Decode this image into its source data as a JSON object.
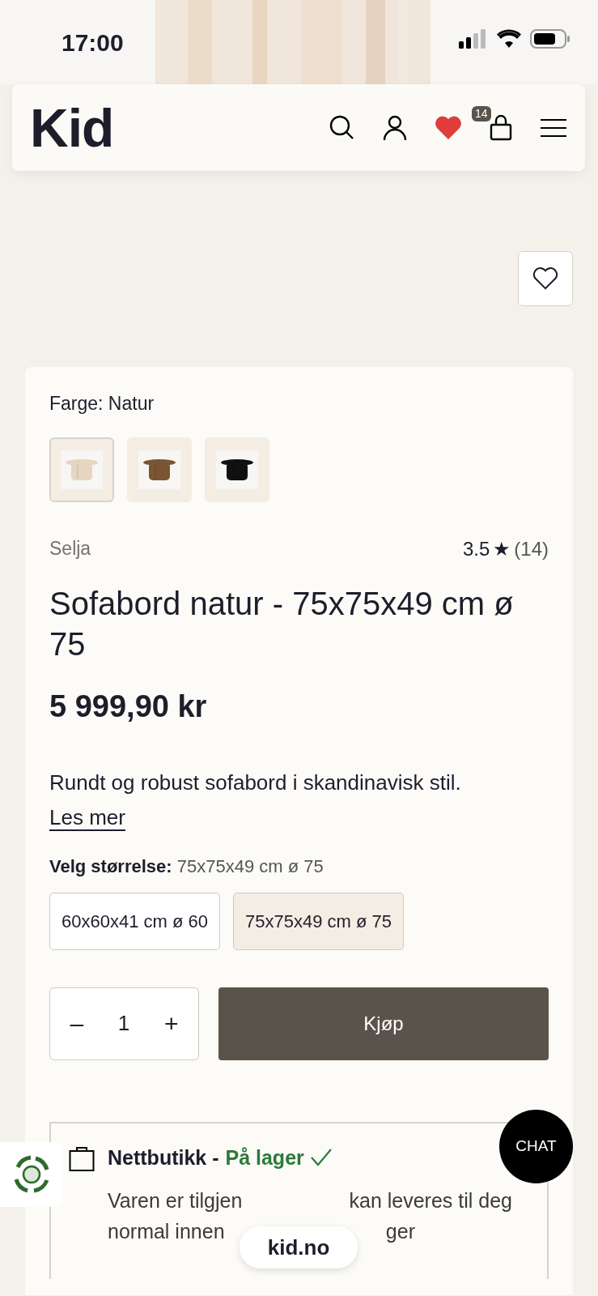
{
  "status_bar": {
    "time": "17:00"
  },
  "header": {
    "logo": "Kid",
    "cart_count": "14"
  },
  "product": {
    "color_label": "Farge:",
    "color_value": "Natur",
    "swatches": [
      {
        "color": "#e6d6c0",
        "selected": true
      },
      {
        "color": "#7a5533",
        "selected": false
      },
      {
        "color": "#111111",
        "selected": false
      }
    ],
    "brand": "Selja",
    "rating": "3.5",
    "rating_star": "★",
    "review_count": "(14)",
    "title": "Sofabord natur - 75x75x49 cm ø 75",
    "price": "5 999,90 kr",
    "description": "Rundt og robust sofabord i skandinavisk stil.",
    "read_more": "Les mer",
    "size_label": "Velg størrelse:",
    "size_value": "75x75x49 cm ø 75",
    "sizes": [
      {
        "label": "60x60x41 cm ø 60",
        "selected": false
      },
      {
        "label": "75x75x49 cm ø 75",
        "selected": true
      }
    ],
    "quantity": {
      "minus": "–",
      "value": "1",
      "plus": "+"
    },
    "buy_button": "Kjøp",
    "stock": {
      "store": "Nettbutikk -",
      "status": "På lager",
      "lines": [
        [
          "Varen er tilgjen",
          "kan leveres til deg"
        ],
        [
          "normal innen",
          "ger"
        ]
      ]
    }
  },
  "chat_button": "CHAT",
  "browser_url": "kid.no"
}
